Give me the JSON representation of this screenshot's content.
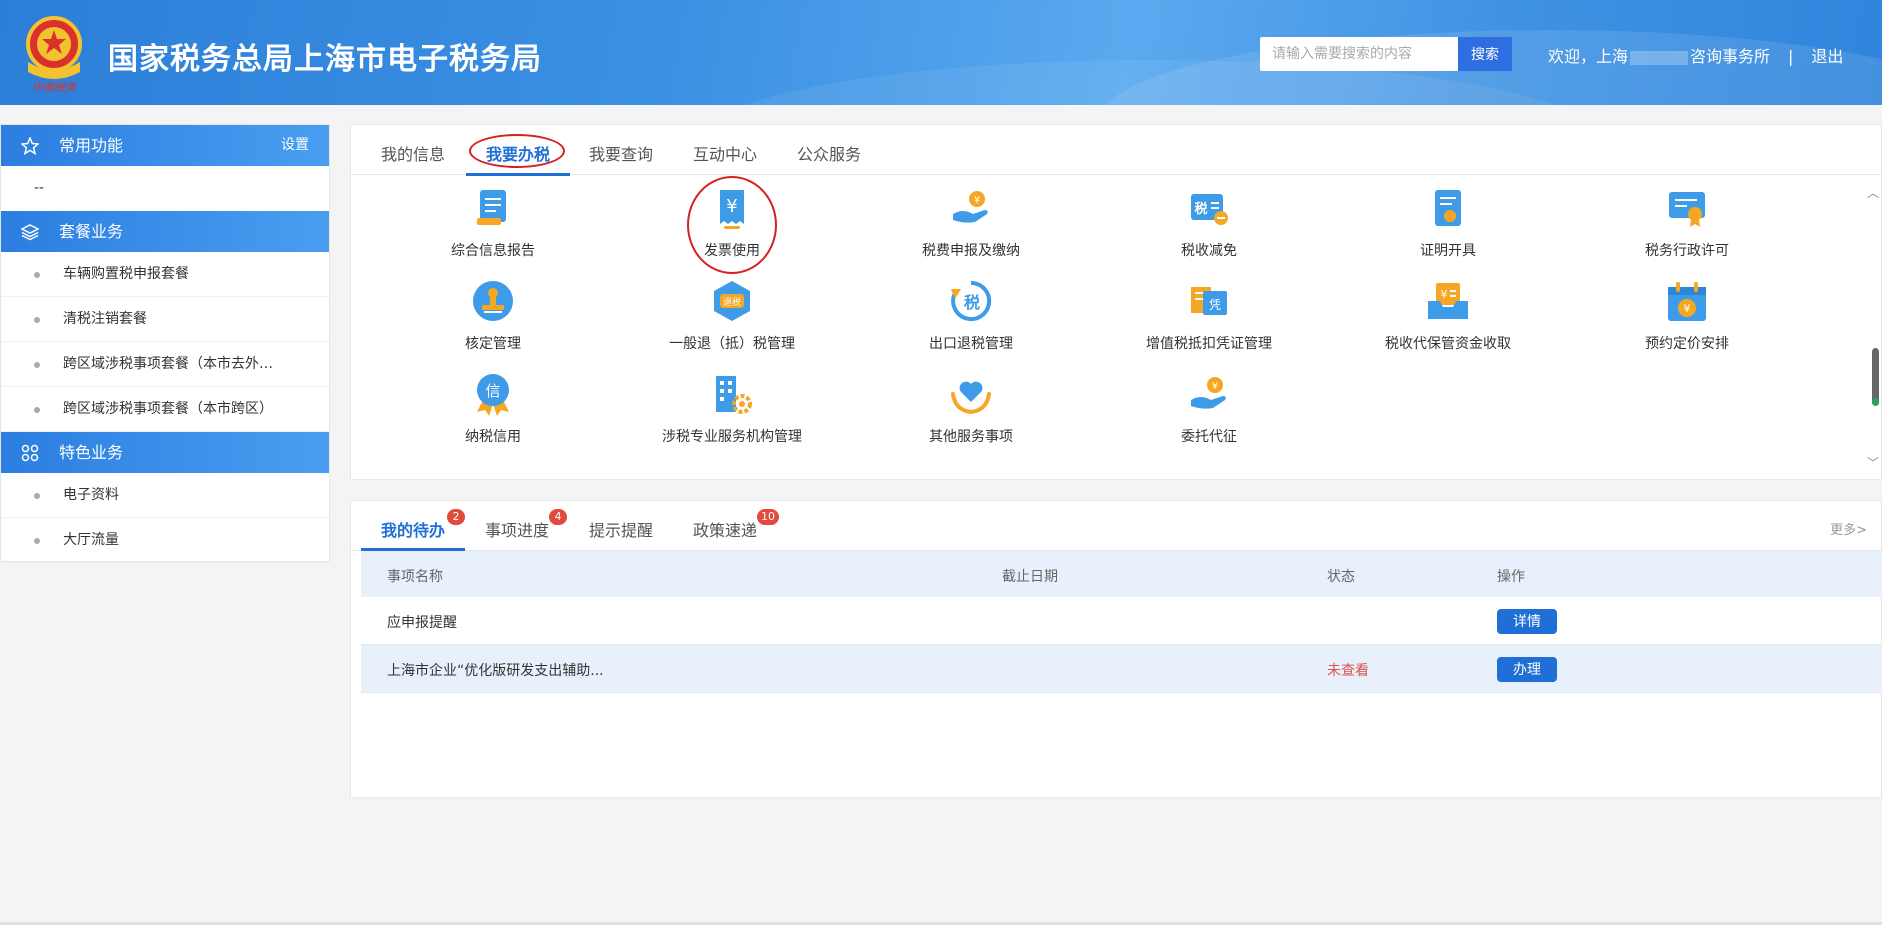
{
  "header": {
    "site_title": "国家税务总局上海市电子税务局",
    "emblem_caption": "中国税务",
    "search_placeholder": "请输入需要搜索的内容",
    "search_button": "搜索",
    "welcome": "欢迎，上海",
    "company_suffix": "咨询事务所",
    "separator": "|",
    "logout": "退出"
  },
  "sidebar": {
    "common": {
      "title": "常用功能",
      "settings": "设置",
      "items": [
        "--"
      ]
    },
    "package": {
      "title": "套餐业务",
      "items": [
        "车辆购置税申报套餐",
        "清税注销套餐",
        "跨区域涉税事项套餐（本市去外…",
        "跨区域涉税事项套餐（本市跨区）"
      ]
    },
    "special": {
      "title": "特色业务",
      "items": [
        "电子资料",
        "大厅流量"
      ]
    }
  },
  "main_tabs": [
    "我的信息",
    "我要办税",
    "我要查询",
    "互动中心",
    "公众服务"
  ],
  "active_tab": "我要办税",
  "services": [
    {
      "label": "综合信息报告",
      "icon": "document-report-icon"
    },
    {
      "label": "发票使用",
      "icon": "invoice-yen-icon"
    },
    {
      "label": "税费申报及缴纳",
      "icon": "hand-coin-icon"
    },
    {
      "label": "税收减免",
      "icon": "tax-reduction-icon"
    },
    {
      "label": "证明开具",
      "icon": "certificate-icon"
    },
    {
      "label": "税务行政许可",
      "icon": "license-award-icon"
    },
    {
      "label": "核定管理",
      "icon": "stamp-icon"
    },
    {
      "label": "一般退（抵）税管理",
      "icon": "tax-refund-icon"
    },
    {
      "label": "出口退税管理",
      "icon": "export-refund-icon"
    },
    {
      "label": "增值税抵扣凭证管理",
      "icon": "voucher-icon"
    },
    {
      "label": "税收代保管资金收取",
      "icon": "fund-tray-icon"
    },
    {
      "label": "预约定价安排",
      "icon": "calendar-yen-icon"
    },
    {
      "label": "纳税信用",
      "icon": "credit-medal-icon"
    },
    {
      "label": "涉税专业服务机构管理",
      "icon": "building-gear-icon"
    },
    {
      "label": "其他服务事项",
      "icon": "hand-heart-icon"
    },
    {
      "label": "委托代征",
      "icon": "hand-coin-icon"
    }
  ],
  "todo": {
    "tabs": [
      {
        "label": "我的待办",
        "badge": "2"
      },
      {
        "label": "事项进度",
        "badge": "4"
      },
      {
        "label": "提示提醒",
        "badge": ""
      },
      {
        "label": "政策速递",
        "badge": "10"
      }
    ],
    "more": "更多>",
    "columns": [
      "事项名称",
      "截止日期",
      "状态",
      "操作"
    ],
    "rows": [
      {
        "name": "应申报提醒",
        "deadline": "",
        "status": "",
        "action": "详情"
      },
      {
        "name": "上海市企业“优化版研发支出辅助...",
        "deadline": "",
        "status": "未查看",
        "action": "办理"
      }
    ]
  },
  "colors": {
    "primary": "#1f6fd6",
    "header_blue": "#3a90e3",
    "highlight_red": "#d62020",
    "icon_blue": "#3d9be8",
    "icon_orange": "#f5a623"
  }
}
